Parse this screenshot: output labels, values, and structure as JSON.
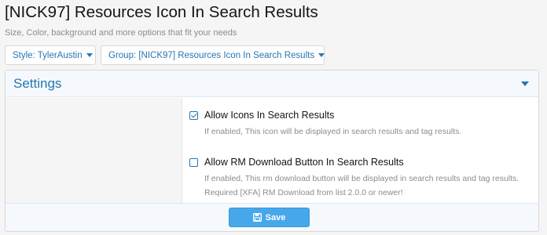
{
  "page": {
    "title": "[NICK97] Resources Icon In Search Results",
    "subtitle": "Size, Color, background and more options that fit your needs"
  },
  "filters": {
    "style_label": "Style: TylerAustin",
    "group_label": "Group: [NICK97] Resources Icon In Search Results"
  },
  "settings": {
    "header": "Settings",
    "options": [
      {
        "label": "Allow Icons In Search Results",
        "hint": "If enabled, This icon will be displayed in search results and tag results.",
        "checked": true
      },
      {
        "label": "Allow RM Download Button In Search Results",
        "hint": "If enabled, This rm download button will be displayed in search results and tag results. Required [XFA] RM Download from list 2.0.0 or newer!",
        "checked": false
      }
    ]
  },
  "footer": {
    "save_label": "Save",
    "save_icon": "floppy-disk-icon"
  },
  "colors": {
    "accent": "#2577b1",
    "button": "#47a7eb",
    "header_bg": "#f5f9fd"
  }
}
